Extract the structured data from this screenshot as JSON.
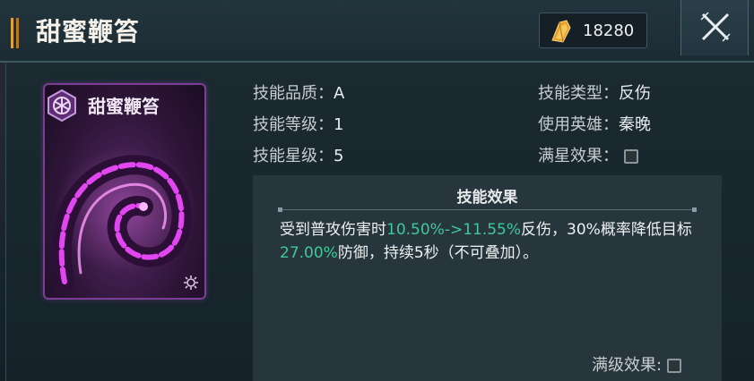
{
  "header": {
    "title": "甜蜜鞭笞",
    "currency_value": "18280",
    "currency_icon": "gold-crystal-icon",
    "close_icon": "close-icon"
  },
  "card": {
    "name": "甜蜜鞭笞",
    "badge_icon": "hexagon-emblem-icon",
    "corner_icon": "gear-icon",
    "art": "purple-whip-art"
  },
  "stats": {
    "quality_label": "技能品质：",
    "quality_value": "A",
    "level_label": "技能等级：",
    "level_value": "1",
    "star_label": "技能星级：",
    "star_value": "5",
    "type_label": "技能类型：",
    "type_value": "反伤",
    "hero_label": "使用英雄：",
    "hero_value": "秦晚",
    "max_star_label": "满星效果：",
    "max_star_checked": false
  },
  "effect": {
    "title": "技能效果",
    "line_part1": "受到普攻伤害时",
    "line_hl1": "10.50%->11.55%",
    "line_part2": "反伤，30%概率降低目标",
    "line_hl2": "27.00%",
    "line_part3": "防御，持续5秒（不可叠加）。",
    "max_level_label": "满级效果:",
    "max_level_checked": false
  },
  "colors": {
    "highlight": "#3ec99a",
    "card_border": "#7a3f92",
    "accent": "#e0a23a"
  }
}
